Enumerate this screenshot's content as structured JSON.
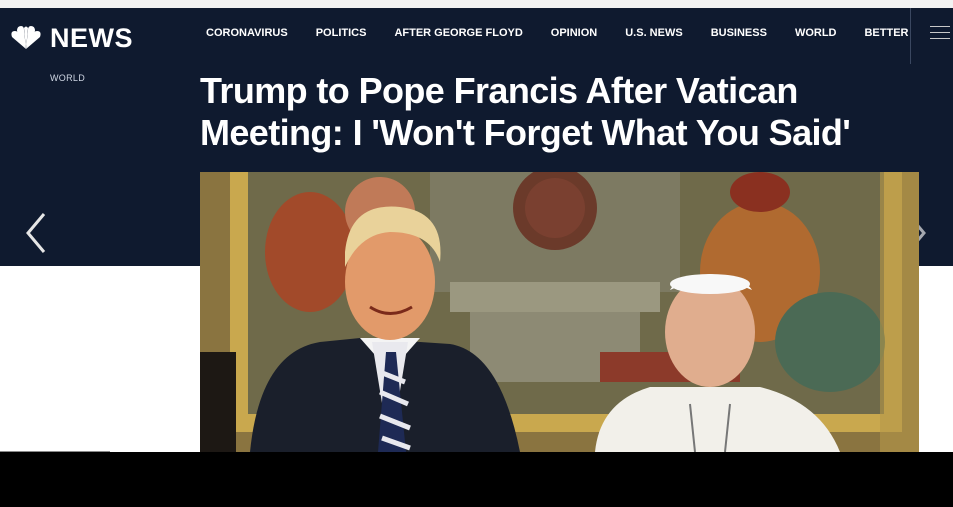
{
  "brand": {
    "name": "NEWS",
    "logo_icon": "nbc-peacock-icon"
  },
  "nav": {
    "items": [
      {
        "label": "CORONAVIRUS"
      },
      {
        "label": "POLITICS"
      },
      {
        "label": "AFTER GEORGE FLOYD"
      },
      {
        "label": "OPINION"
      },
      {
        "label": "U.S. NEWS"
      },
      {
        "label": "BUSINESS"
      },
      {
        "label": "WORLD"
      },
      {
        "label": "BETTER"
      }
    ],
    "menu_icon": "hamburger-menu-icon"
  },
  "article": {
    "section": "WORLD",
    "headline": "Trump to Pope Francis After Vatican Meeting: I 'Won't Forget What You Said'"
  },
  "carousel": {
    "prev_icon": "chevron-left-icon",
    "next_icon": "chevron-right-icon"
  },
  "colors": {
    "hero_bg": "#0f1a2f",
    "text": "#ffffff",
    "page_bg": "#ffffff"
  }
}
